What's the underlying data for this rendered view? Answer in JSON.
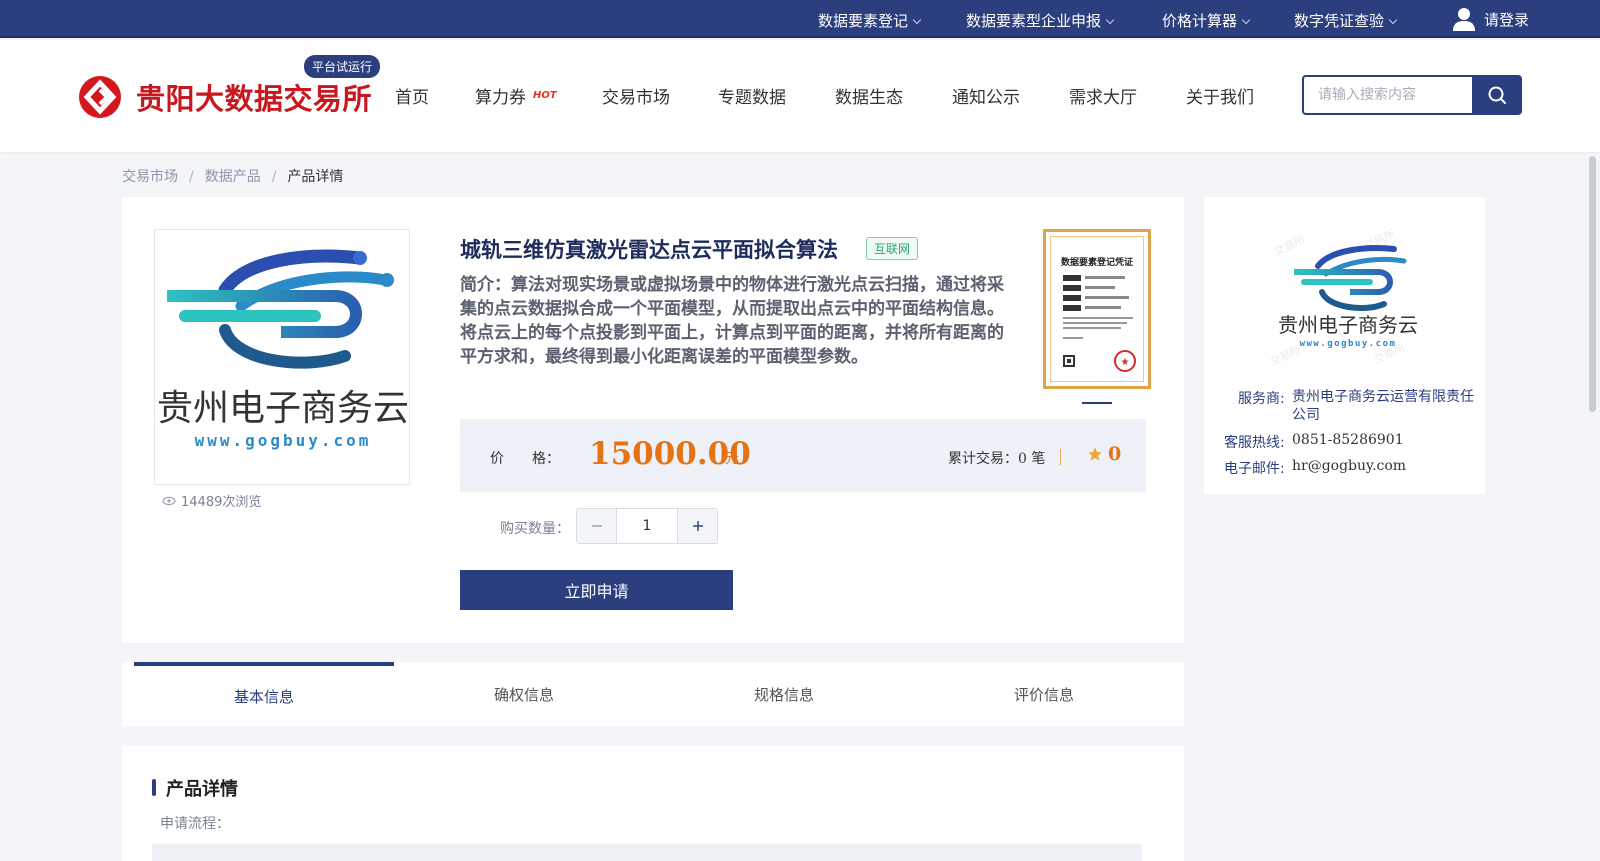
{
  "topbar": {
    "links": [
      "数据要素登记",
      "数据要素型企业申报",
      "价格计算器",
      "数字凭证查验"
    ],
    "login_label": "请登录"
  },
  "header": {
    "brand": "贵阳大数据交易所",
    "badge": "平台试运行",
    "nav": [
      "首页",
      "算力券",
      "交易市场",
      "专题数据",
      "数据生态",
      "通知公示",
      "需求大厅",
      "关于我们"
    ],
    "hot_label": "HOT",
    "search_placeholder": "请输入搜索内容"
  },
  "breadcrumb": [
    "交易市场",
    "数据产品",
    "产品详情"
  ],
  "product": {
    "title": "城轨三维仿真激光雷达点云平面拟合算法",
    "tag": "互联网",
    "description": "简介：算法对现实场景或虚拟场景中的物体进行激光点云扫描，通过将采集的点云数据拟合成一个平面模型，从而提取出点云中的平面结构信息。将点云上的每个点投影到平面上，计算点到平面的距离，并将所有距离的平方求和，最终得到最小化距离误差的平面模型参数。",
    "views": "14489次浏览",
    "image_text": "贵州电子商务云",
    "image_url_text": "www.gogbuy.com",
    "cert_title": "数据要素登记凭证",
    "price_label": "价　　格：",
    "price": "15000.00",
    "price_unit": "元",
    "trades_label": "累计交易：",
    "trades_value": "0 笔",
    "rating": "0",
    "qty_label": "购买数量：",
    "qty_value": "1",
    "apply_label": "立即申请"
  },
  "provider": {
    "image_text": "贵州电子商务云",
    "image_url_text": "www.gogbuy.com",
    "service_label": "服务商:",
    "service_value": "贵州电子商务云运营有限责任公司",
    "hotline_label": "客服热线:",
    "hotline_value": "0851-85286901",
    "email_label": "电子邮件:",
    "email_value": "hr@gogbuy.com"
  },
  "tabs": [
    "基本信息",
    "确权信息",
    "规格信息",
    "评价信息"
  ],
  "detail": {
    "title": "产品详情",
    "subtitle": "申请流程："
  },
  "colors": {
    "primary": "#2b3e7e",
    "brand_red": "#c8171e",
    "price": "#e37315"
  }
}
